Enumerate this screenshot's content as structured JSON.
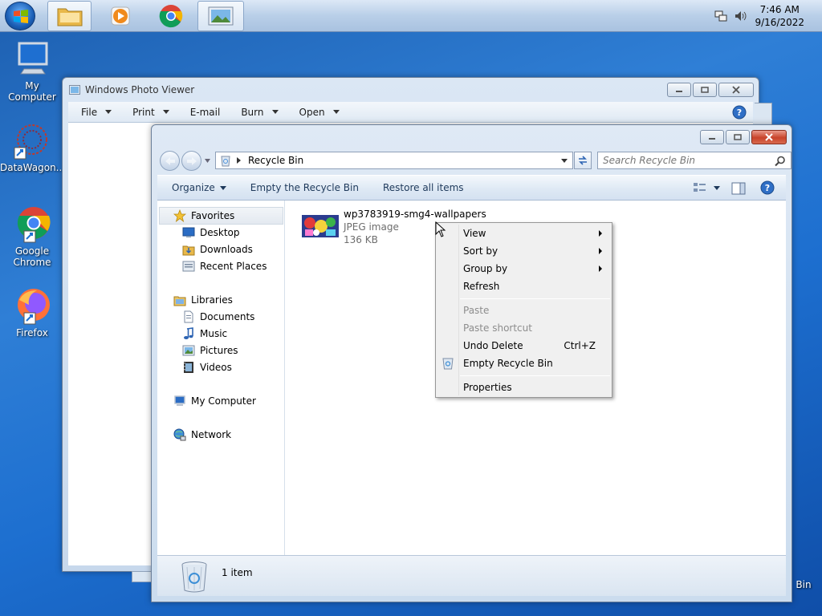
{
  "taskbar": {
    "time": "7:46 AM",
    "date": "9/16/2022",
    "pinned": [
      "file-explorer",
      "media-player",
      "chrome",
      "photo-viewer"
    ]
  },
  "desktop": {
    "icons": [
      {
        "label": "My Computer"
      },
      {
        "label": "DataWagon..."
      },
      {
        "label": "Google Chrome"
      },
      {
        "label": "Firefox"
      },
      {
        "label": "Bin"
      }
    ]
  },
  "photo_viewer": {
    "title": "Windows Photo Viewer",
    "menus": [
      "File",
      "Print",
      "E-mail",
      "Burn",
      "Open"
    ]
  },
  "explorer": {
    "address": "Recycle Bin",
    "search_placeholder": "Search Recycle Bin",
    "commands": {
      "organize": "Organize",
      "empty": "Empty the Recycle Bin",
      "restore": "Restore all items"
    },
    "nav": {
      "favorites": "Favorites",
      "desktop": "Desktop",
      "downloads": "Downloads",
      "recent": "Recent Places",
      "libraries": "Libraries",
      "documents": "Documents",
      "music": "Music",
      "pictures": "Pictures",
      "videos": "Videos",
      "computer": "My Computer",
      "network": "Network"
    },
    "file": {
      "name": "wp3783919-smg4-wallpapers",
      "type": "JPEG image",
      "size": "136 KB"
    },
    "status": "1 item"
  },
  "context_menu": {
    "view": "View",
    "sort_by": "Sort by",
    "group_by": "Group by",
    "refresh": "Refresh",
    "paste": "Paste",
    "paste_shortcut": "Paste shortcut",
    "undo_delete": "Undo Delete",
    "undo_shortcut": "Ctrl+Z",
    "empty_bin": "Empty Recycle Bin",
    "properties": "Properties"
  },
  "colors": {
    "desktop_blue": "#2f7fd6",
    "command_text": "#1e395b",
    "close_red": "#c8432a"
  }
}
